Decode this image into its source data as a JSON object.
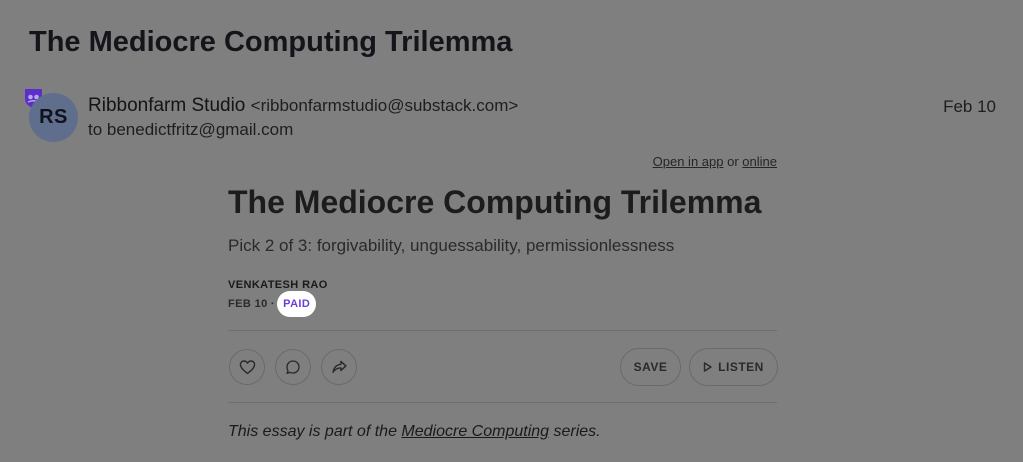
{
  "email": {
    "subject": "The Mediocre Computing Trilemma",
    "sender": {
      "initials": "RS",
      "name": "Ribbonfarm Studio",
      "email": "<ribbonfarmstudio@substack.com>",
      "recipient": "to benedictfritz@gmail.com",
      "badge_icon": "shield-icon",
      "badge_color": "#5b2fc9"
    },
    "date": "Feb 10"
  },
  "open_links": {
    "open_in_app": "Open in app",
    "or": "or",
    "online": "online"
  },
  "post": {
    "title": "The Mediocre Computing Trilemma",
    "subtitle": "Pick 2 of 3: forgivability, unguessability, permissionlessness",
    "author": "VENKATESH RAO",
    "date": "FEB 10",
    "separator": "∙",
    "paid_label": "PAID",
    "paid_color": "#6a3fd6"
  },
  "actions": {
    "like_icon": "heart-icon",
    "comment_icon": "comment-icon",
    "share_icon": "share-icon",
    "save_label": "SAVE",
    "listen_label": "LISTEN",
    "listen_icon": "play-icon"
  },
  "series_note": {
    "prefix": "This essay is part of the",
    "link": "Mediocre Computing",
    "suffix": "series."
  }
}
